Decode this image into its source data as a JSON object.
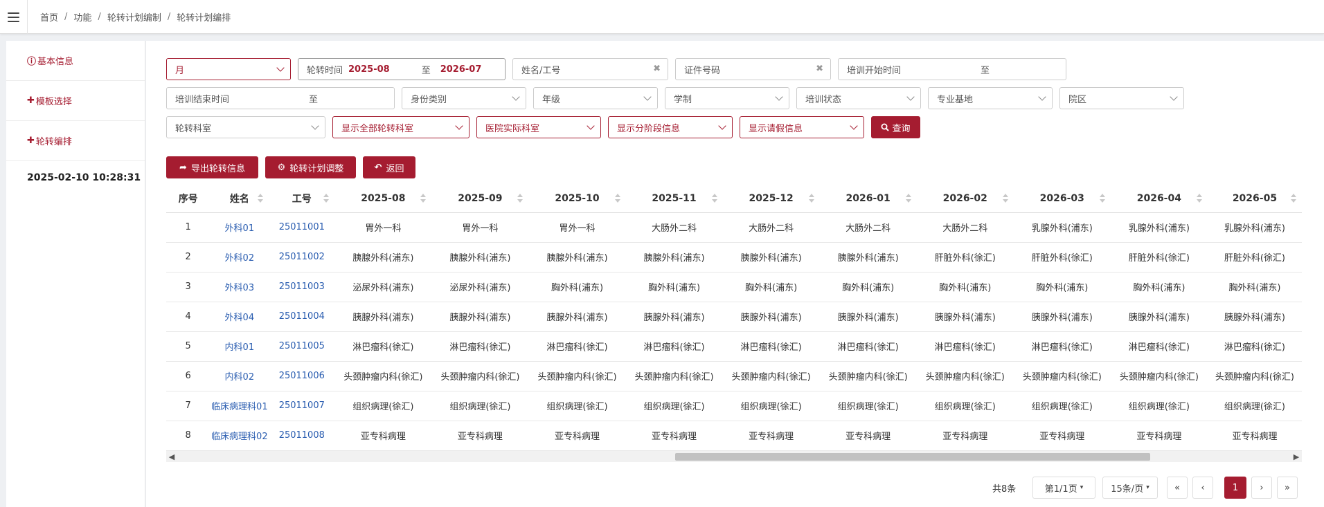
{
  "breadcrumb": [
    "首页",
    "功能",
    "轮转计划编制",
    "轮转计划编排"
  ],
  "sidebar": {
    "items": [
      {
        "icon": "info-circle-icon",
        "glyph": "ⓘ",
        "label": "基本信息"
      },
      {
        "icon": "plus-icon",
        "glyph": "✚",
        "label": "模板选择"
      },
      {
        "icon": "plus-icon",
        "glyph": "✚",
        "label": "轮转编排"
      }
    ],
    "datetime": "2025-02-10 10:28:31"
  },
  "filters": {
    "period": "月",
    "rotation_time_label": "轮转时间",
    "rotation_start": "2025-08",
    "to": "至",
    "rotation_end": "2026-07",
    "name_placeholder": "姓名/工号",
    "idno_placeholder": "证件号码",
    "train_start_label": "培训开始时间",
    "train_end_label": "培训结束时间",
    "identity": "身份类别",
    "grade": "年级",
    "schooling": "学制",
    "train_status": "培训状态",
    "base": "专业基地",
    "campus": "院区",
    "dept": "轮转科室",
    "show_all": "显示全部轮转科室",
    "actual_dept": "医院实际科室",
    "phase_info": "显示分阶段信息",
    "leave_info": "显示请假信息",
    "query": "查询",
    "clear_glyph": "✖"
  },
  "actions": {
    "export": "导出轮转信息",
    "adjust": "轮转计划调整",
    "back": "返回"
  },
  "table": {
    "headers": [
      "序号",
      "姓名",
      "工号",
      "2025-08",
      "2025-09",
      "2025-10",
      "2025-11",
      "2025-12",
      "2026-01",
      "2026-02",
      "2026-03",
      "2026-04",
      "2026-05"
    ],
    "rows": [
      [
        "1",
        "外科01",
        "25011001",
        "胃外一科",
        "胃外一科",
        "胃外一科",
        "大肠外二科",
        "大肠外二科",
        "大肠外二科",
        "大肠外二科",
        "乳腺外科(浦东)",
        "乳腺外科(浦东)",
        "乳腺外科(浦东)"
      ],
      [
        "2",
        "外科02",
        "25011002",
        "胰腺外科(浦东)",
        "胰腺外科(浦东)",
        "胰腺外科(浦东)",
        "胰腺外科(浦东)",
        "胰腺外科(浦东)",
        "胰腺外科(浦东)",
        "肝脏外科(徐汇)",
        "肝脏外科(徐汇)",
        "肝脏外科(徐汇)",
        "肝脏外科(徐汇)"
      ],
      [
        "3",
        "外科03",
        "25011003",
        "泌尿外科(浦东)",
        "泌尿外科(浦东)",
        "胸外科(浦东)",
        "胸外科(浦东)",
        "胸外科(浦东)",
        "胸外科(浦东)",
        "胸外科(浦东)",
        "胸外科(浦东)",
        "胸外科(浦东)",
        "胸外科(浦东)"
      ],
      [
        "4",
        "外科04",
        "25011004",
        "胰腺外科(浦东)",
        "胰腺外科(浦东)",
        "胰腺外科(浦东)",
        "胰腺外科(浦东)",
        "胰腺外科(浦东)",
        "胰腺外科(浦东)",
        "胰腺外科(浦东)",
        "胰腺外科(浦东)",
        "胰腺外科(浦东)",
        "胰腺外科(浦东)"
      ],
      [
        "5",
        "内科01",
        "25011005",
        "淋巴瘤科(徐汇)",
        "淋巴瘤科(徐汇)",
        "淋巴瘤科(徐汇)",
        "淋巴瘤科(徐汇)",
        "淋巴瘤科(徐汇)",
        "淋巴瘤科(徐汇)",
        "淋巴瘤科(徐汇)",
        "淋巴瘤科(徐汇)",
        "淋巴瘤科(徐汇)",
        "淋巴瘤科(徐汇)"
      ],
      [
        "6",
        "内科02",
        "25011006",
        "头颈肿瘤内科(徐汇)",
        "头颈肿瘤内科(徐汇)",
        "头颈肿瘤内科(徐汇)",
        "头颈肿瘤内科(徐汇)",
        "头颈肿瘤内科(徐汇)",
        "头颈肿瘤内科(徐汇)",
        "头颈肿瘤内科(徐汇)",
        "头颈肿瘤内科(徐汇)",
        "头颈肿瘤内科(徐汇)",
        "头颈肿瘤内科(徐汇)"
      ],
      [
        "7",
        "临床病理科01",
        "25011007",
        "组织病理(徐汇)",
        "组织病理(徐汇)",
        "组织病理(徐汇)",
        "组织病理(徐汇)",
        "组织病理(徐汇)",
        "组织病理(徐汇)",
        "组织病理(徐汇)",
        "组织病理(徐汇)",
        "组织病理(徐汇)",
        "组织病理(徐汇)"
      ],
      [
        "8",
        "临床病理科02",
        "25011008",
        "亚专科病理",
        "亚专科病理",
        "亚专科病理",
        "亚专科病理",
        "亚专科病理",
        "亚专科病理",
        "亚专科病理",
        "亚专科病理",
        "亚专科病理",
        "亚专科病理"
      ]
    ]
  },
  "pagination": {
    "total": "共8条",
    "page": "第1/1页",
    "per_page": "15条/页",
    "first": "«",
    "prev": "‹",
    "current": "1",
    "next": "›",
    "last": "»"
  },
  "colors": {
    "accent": "#a51c30",
    "link": "#2a5db0"
  }
}
